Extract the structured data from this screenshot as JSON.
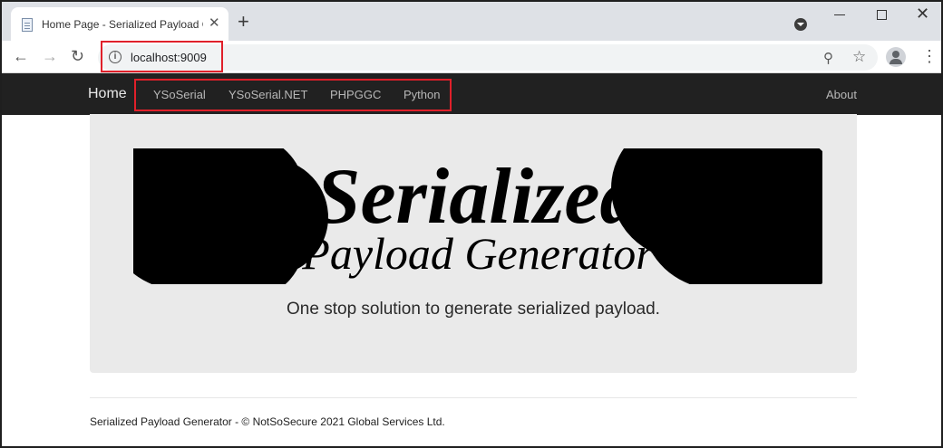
{
  "browser": {
    "tab_title": "Home Page - Serialized Payload Generator",
    "tab_close": "✕",
    "new_tab": "+",
    "url": "localhost:9009",
    "win_close": "✕"
  },
  "navbar": {
    "brand": "Home",
    "links": [
      "YSoSerial",
      "YSoSerial.NET",
      "PHPGGC",
      "Python"
    ],
    "about": "About"
  },
  "hero": {
    "logo_title": "Serialized",
    "logo_subtitle": "Payload Generator",
    "lead": "One stop solution to generate serialized payload."
  },
  "footer": {
    "text": "Serialized Payload Generator - © NotSoSecure 2021 Global Services Ltd."
  },
  "colors": {
    "highlight": "#e0202a",
    "navbar_bg": "#212121",
    "hero_bg": "#eaeaea"
  }
}
